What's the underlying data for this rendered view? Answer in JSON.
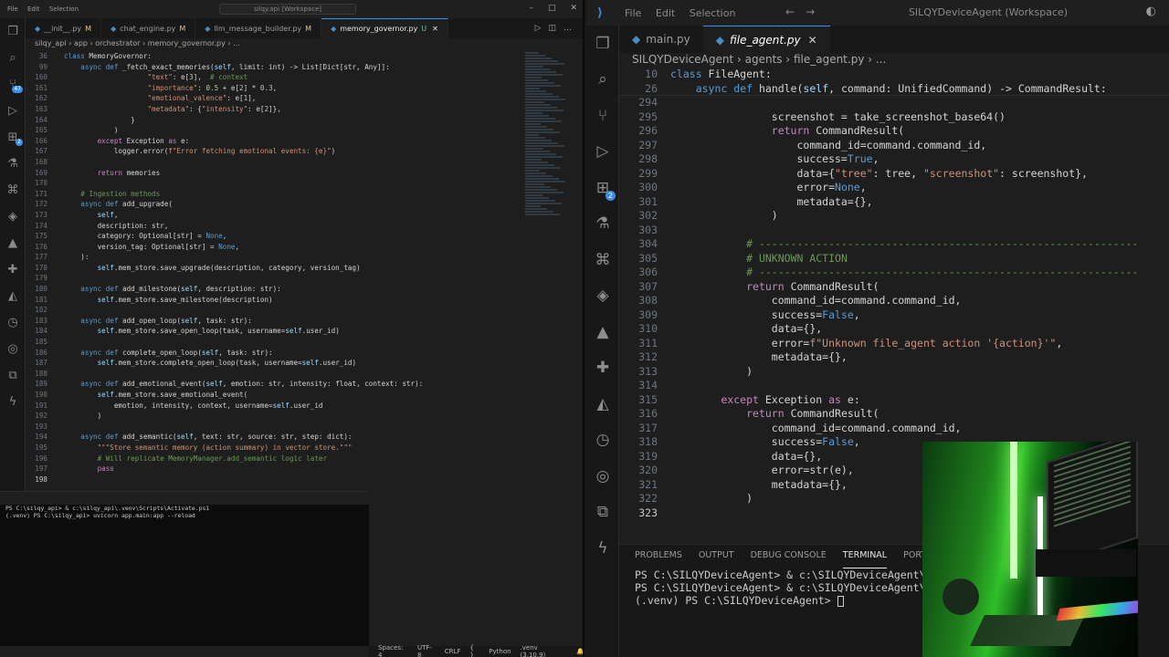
{
  "left_window": {
    "title_menu": [
      "File",
      "Edit",
      "Selection"
    ],
    "search": "silqy.api [Workspace]",
    "tabs": [
      {
        "label": "__init__.py",
        "badge": "M"
      },
      {
        "label": "chat_engine.py",
        "badge": "M"
      },
      {
        "label": "llm_message_builder.py",
        "badge": "M"
      },
      {
        "label": "memory_governor.py",
        "badge": "U",
        "active": true
      }
    ],
    "breadcrumb": "silqy_api  ›  app  ›  orchestrator  ›  memory_governor.py  ›  ...",
    "activity_badge": "47",
    "activity_badge2": "2",
    "code_lines": [
      {
        "n": "36",
        "t": "class MemoryGovernor:"
      },
      {
        "n": "99",
        "t": "    async def _fetch_exact_memories(self, limit: int) -> List[Dict[str, Any]]:"
      },
      {
        "n": "160",
        "t": "                    \"text\": e[3],  # context"
      },
      {
        "n": "161",
        "t": "                    \"importance\": 0.5 + e[2] * 0.3,"
      },
      {
        "n": "162",
        "t": "                    \"emotional_valence\": e[1],"
      },
      {
        "n": "163",
        "t": "                    \"metadata\": {\"intensity\": e[2]},"
      },
      {
        "n": "164",
        "t": "                }"
      },
      {
        "n": "165",
        "t": "            )"
      },
      {
        "n": "166",
        "t": "        except Exception as e:"
      },
      {
        "n": "167",
        "t": "            logger.error(f\"Error fetching emotional events: {e}\")"
      },
      {
        "n": "168",
        "t": ""
      },
      {
        "n": "169",
        "t": "        return memories"
      },
      {
        "n": "170",
        "t": ""
      },
      {
        "n": "171",
        "t": "    # Ingestion methods"
      },
      {
        "n": "172",
        "t": "    async def add_upgrade("
      },
      {
        "n": "173",
        "t": "        self,"
      },
      {
        "n": "174",
        "t": "        description: str,"
      },
      {
        "n": "175",
        "t": "        category: Optional[str] = None,"
      },
      {
        "n": "176",
        "t": "        version_tag: Optional[str] = None,"
      },
      {
        "n": "177",
        "t": "    ):"
      },
      {
        "n": "178",
        "t": "        self.mem_store.save_upgrade(description, category, version_tag)"
      },
      {
        "n": "179",
        "t": ""
      },
      {
        "n": "180",
        "t": "    async def add_milestone(self, description: str):"
      },
      {
        "n": "181",
        "t": "        self.mem_store.save_milestone(description)"
      },
      {
        "n": "182",
        "t": ""
      },
      {
        "n": "183",
        "t": "    async def add_open_loop(self, task: str):"
      },
      {
        "n": "184",
        "t": "        self.mem_store.save_open_loop(task, username=self.user_id)"
      },
      {
        "n": "185",
        "t": ""
      },
      {
        "n": "186",
        "t": "    async def complete_open_loop(self, task: str):"
      },
      {
        "n": "187",
        "t": "        self.mem_store.complete_open_loop(task, username=self.user_id)"
      },
      {
        "n": "188",
        "t": ""
      },
      {
        "n": "189",
        "t": "    async def add_emotional_event(self, emotion: str, intensity: float, context: str):"
      },
      {
        "n": "190",
        "t": "        self.mem_store.save_emotional_event("
      },
      {
        "n": "191",
        "t": "            emotion, intensity, context, username=self.user_id"
      },
      {
        "n": "192",
        "t": "        )"
      },
      {
        "n": "193",
        "t": ""
      },
      {
        "n": "194",
        "t": "    async def add_semantic(self, text: str, source: str, step: dict):"
      },
      {
        "n": "195",
        "t": "        \"\"\"Store semantic memory (action summary) in vector store.\"\"\""
      },
      {
        "n": "196",
        "t": "        # Will replicate MemoryManager.add_semantic logic later"
      },
      {
        "n": "197",
        "t": "        pass"
      },
      {
        "n": "198",
        "t": ""
      }
    ],
    "terminal_lines": [
      "PS C:\\silqy_api> & c:\\silqy_api\\.venv\\Scripts\\Activate.ps1",
      "(.venv) PS C:\\silqy_api> uvicorn app.main:app --reload"
    ],
    "status": {
      "spaces": "Spaces: 4",
      "encoding": "UTF-8",
      "eol": "CRLF",
      "braces": "{ }",
      "language": "Python",
      "interpreter": ".venv (3.10.9)"
    }
  },
  "right_window": {
    "title_menu": [
      "File",
      "Edit",
      "Selection"
    ],
    "search": "SILQYDeviceAgent (Workspace)",
    "tabs": [
      {
        "label": "main.py"
      },
      {
        "label": "file_agent.py",
        "active": true
      }
    ],
    "breadcrumb": "SILQYDeviceAgent  ›  agents  ›  file_agent.py  ›  ...",
    "activity_badge": "2",
    "code_lines": [
      {
        "n": "10",
        "t": "class FileAgent:"
      },
      {
        "n": "26",
        "t": "    async def handle(self, command: UnifiedCommand) -> CommandResult:"
      },
      {
        "n": "294",
        "t": ""
      },
      {
        "n": "295",
        "t": "                screenshot = take_screenshot_base64()"
      },
      {
        "n": "296",
        "t": "                return CommandResult("
      },
      {
        "n": "297",
        "t": "                    command_id=command.command_id,"
      },
      {
        "n": "298",
        "t": "                    success=True,"
      },
      {
        "n": "299",
        "t": "                    data={\"tree\": tree, \"screenshot\": screenshot},"
      },
      {
        "n": "300",
        "t": "                    error=None,"
      },
      {
        "n": "301",
        "t": "                    metadata={},"
      },
      {
        "n": "302",
        "t": "                )"
      },
      {
        "n": "303",
        "t": ""
      },
      {
        "n": "304",
        "t": "            # ------------------------------------------------------------"
      },
      {
        "n": "305",
        "t": "            # UNKNOWN ACTION"
      },
      {
        "n": "306",
        "t": "            # ------------------------------------------------------------"
      },
      {
        "n": "307",
        "t": "            return CommandResult("
      },
      {
        "n": "308",
        "t": "                command_id=command.command_id,"
      },
      {
        "n": "309",
        "t": "                success=False,"
      },
      {
        "n": "310",
        "t": "                data={},"
      },
      {
        "n": "311",
        "t": "                error=f\"Unknown file_agent action '{action}'\","
      },
      {
        "n": "312",
        "t": "                metadata={},"
      },
      {
        "n": "313",
        "t": "            )"
      },
      {
        "n": "314",
        "t": ""
      },
      {
        "n": "315",
        "t": "        except Exception as e:"
      },
      {
        "n": "316",
        "t": "            return CommandResult("
      },
      {
        "n": "317",
        "t": "                command_id=command.command_id,"
      },
      {
        "n": "318",
        "t": "                success=False,"
      },
      {
        "n": "319",
        "t": "                data={},"
      },
      {
        "n": "320",
        "t": "                error=str(e),"
      },
      {
        "n": "321",
        "t": "                metadata={},"
      },
      {
        "n": "322",
        "t": "            )"
      },
      {
        "n": "323",
        "t": ""
      }
    ],
    "panel_tabs": [
      "PROBLEMS",
      "OUTPUT",
      "DEBUG CONSOLE",
      "TERMINAL",
      "PORTS"
    ],
    "active_panel_tab": "TERMINAL",
    "terminal_lines": [
      "PS C:\\SILQYDeviceAgent> & c:\\SILQYDeviceAgent\\.venv\\S",
      "PS C:\\SILQYDeviceAgent> & c:\\SILQYDeviceAgent\\.venv\\S",
      "(.venv) PS C:\\SILQYDeviceAgent> "
    ]
  },
  "icons": {
    "explorer": "files-icon",
    "search": "search-icon",
    "scm": "source-control-icon",
    "debug": "run-debug-icon",
    "extensions": "extensions-icon",
    "testing": "beaker-icon",
    "python": "python-icon",
    "remote": "remote-explorer-icon"
  }
}
